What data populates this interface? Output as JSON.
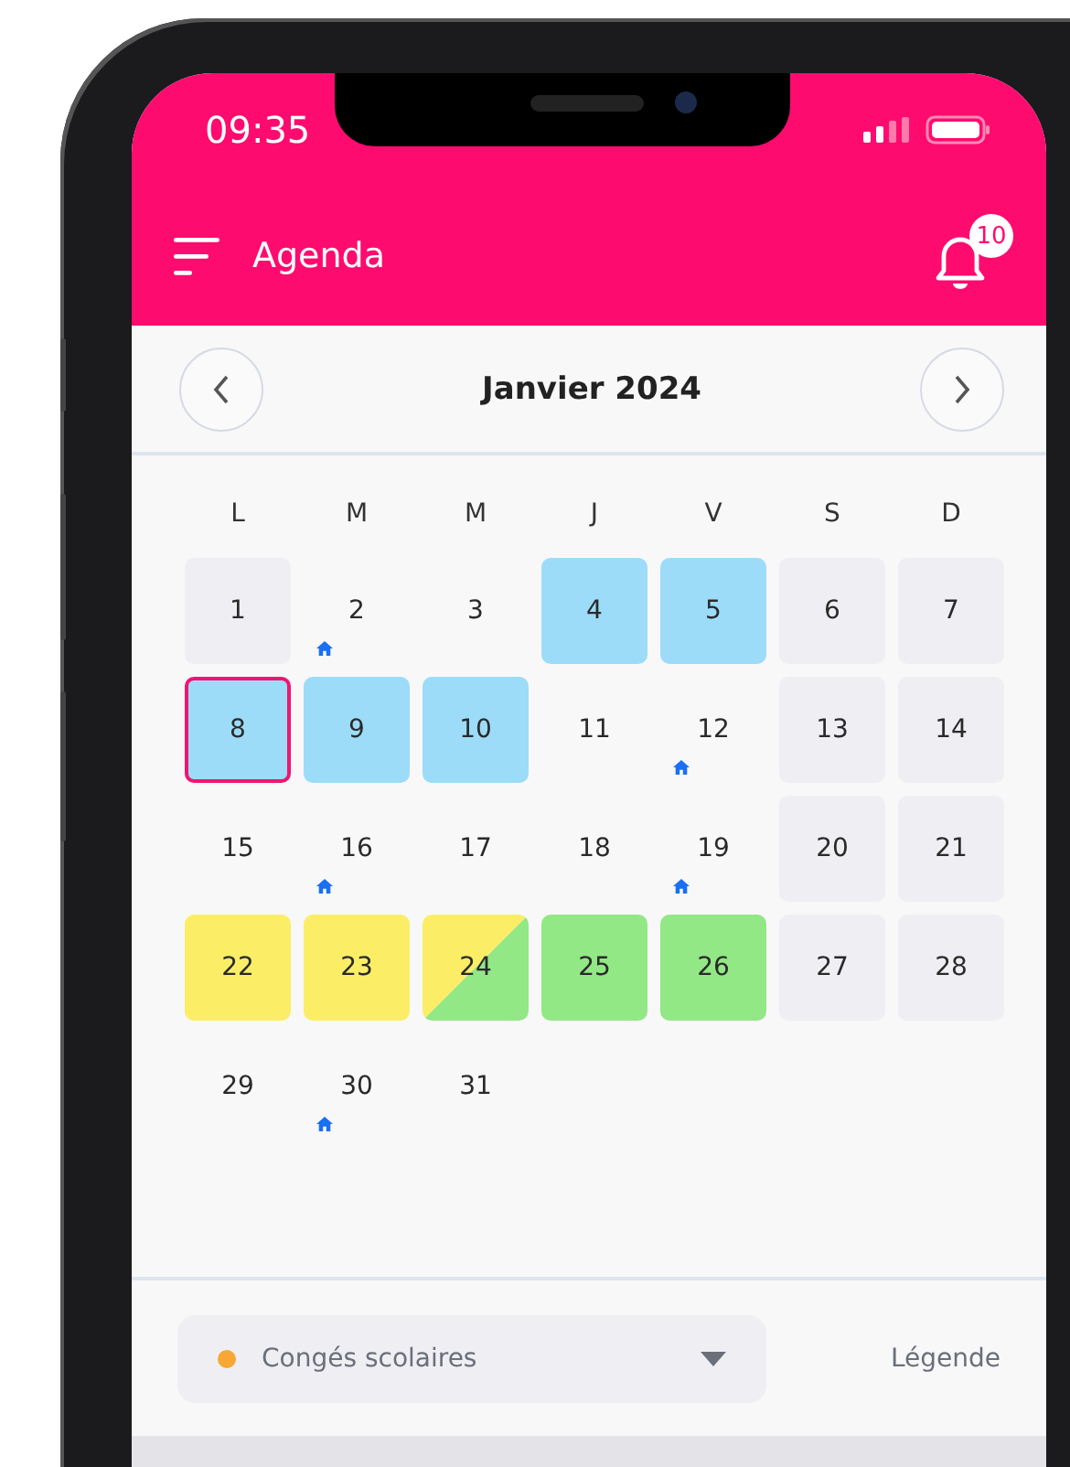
{
  "status_bar": {
    "time": "09:35"
  },
  "app_bar": {
    "title": "Agenda",
    "notification_count": "10"
  },
  "calendar": {
    "month": "Janvier 2024",
    "weekdays": [
      "L",
      "M",
      "M",
      "J",
      "V",
      "S",
      "D"
    ],
    "days": [
      {
        "day": "1",
        "kind": "box",
        "color": "#efeff3",
        "home": false,
        "selected": false
      },
      {
        "day": "2",
        "kind": "plain",
        "home": true,
        "selected": false
      },
      {
        "day": "3",
        "kind": "plain",
        "home": false,
        "selected": false
      },
      {
        "day": "4",
        "kind": "box",
        "color": "#9cdcf9",
        "home": false,
        "selected": false
      },
      {
        "day": "5",
        "kind": "box",
        "color": "#9cdcf9",
        "home": false,
        "selected": false
      },
      {
        "day": "6",
        "kind": "box",
        "color": "#efeff3",
        "home": false,
        "selected": false
      },
      {
        "day": "7",
        "kind": "box",
        "color": "#efeff3",
        "home": false,
        "selected": false
      },
      {
        "day": "8",
        "kind": "box",
        "color": "#9cdcf9",
        "home": false,
        "selected": true
      },
      {
        "day": "9",
        "kind": "box",
        "color": "#9cdcf9",
        "home": false,
        "selected": false
      },
      {
        "day": "10",
        "kind": "box",
        "color": "#9cdcf9",
        "home": false,
        "selected": false
      },
      {
        "day": "11",
        "kind": "plain",
        "home": false,
        "selected": false
      },
      {
        "day": "12",
        "kind": "plain",
        "home": true,
        "selected": false
      },
      {
        "day": "13",
        "kind": "box",
        "color": "#efeff3",
        "home": false,
        "selected": false
      },
      {
        "day": "14",
        "kind": "box",
        "color": "#efeff3",
        "home": false,
        "selected": false
      },
      {
        "day": "15",
        "kind": "plain",
        "home": false,
        "selected": false
      },
      {
        "day": "16",
        "kind": "plain",
        "home": true,
        "selected": false
      },
      {
        "day": "17",
        "kind": "plain",
        "home": false,
        "selected": false
      },
      {
        "day": "18",
        "kind": "plain",
        "home": false,
        "selected": false
      },
      {
        "day": "19",
        "kind": "plain",
        "home": true,
        "selected": false
      },
      {
        "day": "20",
        "kind": "box",
        "color": "#efeff3",
        "home": false,
        "selected": false
      },
      {
        "day": "21",
        "kind": "box",
        "color": "#efeff3",
        "home": false,
        "selected": false
      },
      {
        "day": "22",
        "kind": "box",
        "color": "#fbee66",
        "home": false,
        "selected": false
      },
      {
        "day": "23",
        "kind": "box",
        "color": "#fbee66",
        "home": false,
        "selected": false
      },
      {
        "day": "24",
        "kind": "split",
        "segments": [
          {
            "color": "#fbee66"
          },
          {
            "color": "#92e885"
          }
        ],
        "home": false,
        "selected": false
      },
      {
        "day": "25",
        "kind": "box",
        "color": "#92e885",
        "home": false,
        "selected": false
      },
      {
        "day": "26",
        "kind": "box",
        "color": "#92e885",
        "home": false,
        "selected": false
      },
      {
        "day": "27",
        "kind": "box",
        "color": "#efeff3",
        "home": false,
        "selected": false
      },
      {
        "day": "28",
        "kind": "box",
        "color": "#efeff3",
        "home": false,
        "selected": false
      },
      {
        "day": "29",
        "kind": "plain",
        "home": false,
        "selected": false
      },
      {
        "day": "30",
        "kind": "plain",
        "home": true,
        "selected": false
      },
      {
        "day": "31",
        "kind": "plain",
        "home": false,
        "selected": false
      }
    ]
  },
  "footer": {
    "filter": {
      "label": "Congés scolaires",
      "color": "#f7a734"
    },
    "legend_link": "Légende"
  }
}
